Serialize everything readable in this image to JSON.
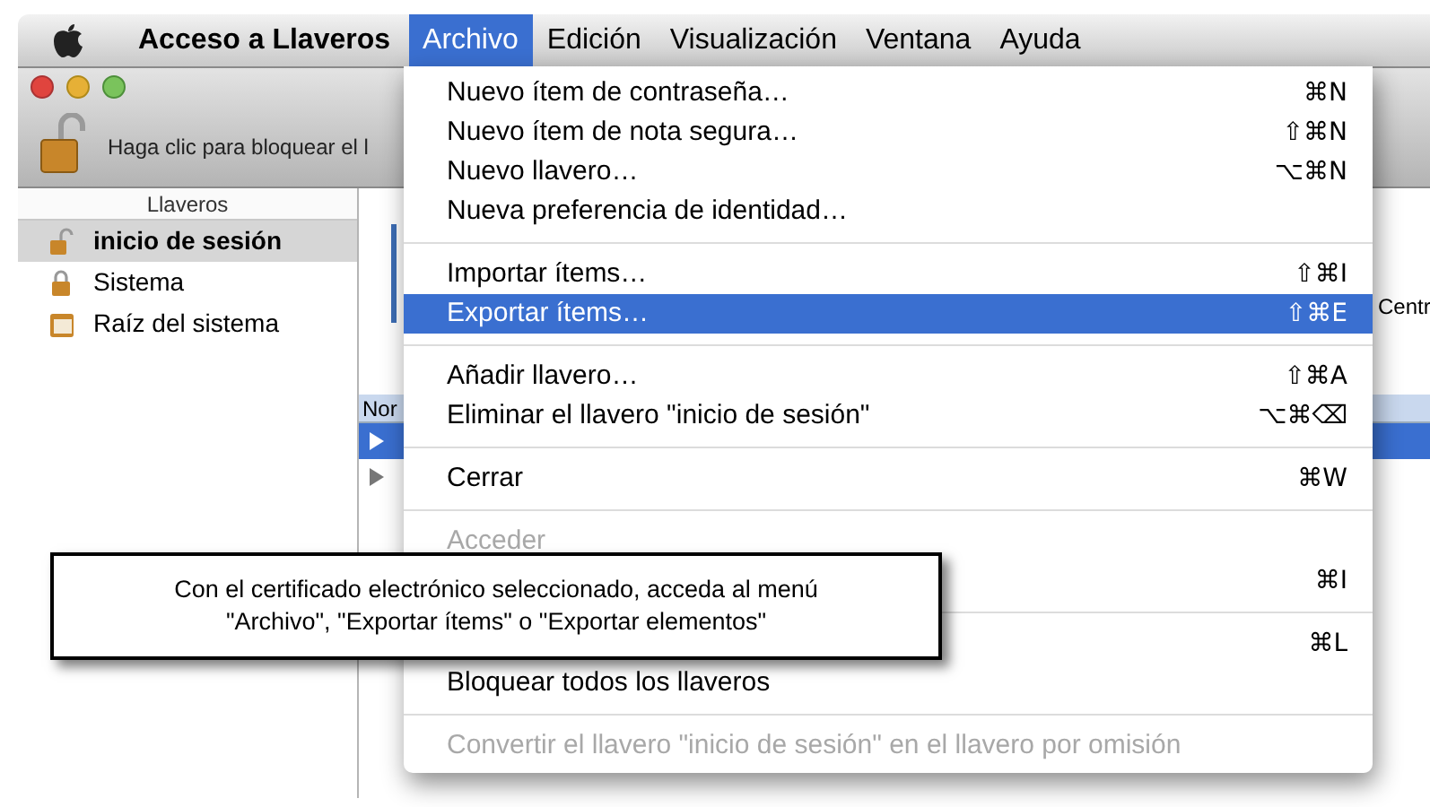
{
  "menu_bar": {
    "app_name": "Acceso a Llaveros",
    "menus": [
      {
        "label": "Archivo",
        "selected": true
      },
      {
        "label": "Edición",
        "selected": false
      },
      {
        "label": "Visualización",
        "selected": false
      },
      {
        "label": "Ventana",
        "selected": false
      },
      {
        "label": "Ayuda",
        "selected": false
      }
    ]
  },
  "window": {
    "toolbar_text": "Haga clic para bloquear el l",
    "sidebar": {
      "header": "Llaveros",
      "items": [
        {
          "label": "inicio de sesión",
          "kind": "unlocked",
          "selected": true
        },
        {
          "label": "Sistema",
          "kind": "locked",
          "selected": false
        },
        {
          "label": "Raíz del sistema",
          "kind": "folder",
          "selected": false
        }
      ]
    },
    "detail_text": "Centr",
    "list": {
      "column_1": "Nor",
      "rows": [
        {
          "selected": true
        },
        {
          "selected": false
        }
      ]
    }
  },
  "file_menu": {
    "items": [
      {
        "kind": "item",
        "label": "Nuevo ítem de contraseña…",
        "shortcut": "⌘N",
        "disabled": false,
        "selected": false
      },
      {
        "kind": "item",
        "label": "Nuevo ítem de nota segura…",
        "shortcut": "⇧⌘N",
        "disabled": false,
        "selected": false
      },
      {
        "kind": "item",
        "label": "Nuevo llavero…",
        "shortcut": "⌥⌘N",
        "disabled": false,
        "selected": false
      },
      {
        "kind": "item",
        "label": "Nueva preferencia de identidad…",
        "disabled": false,
        "selected": false
      },
      {
        "kind": "separator"
      },
      {
        "kind": "item",
        "label": "Importar ítems…",
        "shortcut": "⇧⌘I",
        "disabled": false,
        "selected": false
      },
      {
        "kind": "item",
        "label": "Exportar ítems…",
        "shortcut": "⇧⌘E",
        "disabled": false,
        "selected": true
      },
      {
        "kind": "separator"
      },
      {
        "kind": "item",
        "label": "Añadir llavero…",
        "shortcut": "⇧⌘A",
        "disabled": false,
        "selected": false
      },
      {
        "kind": "item",
        "label": "Eliminar el llavero \"inicio de sesión\"",
        "shortcut": "⌥⌘⌫",
        "disabled": false,
        "selected": false
      },
      {
        "kind": "separator"
      },
      {
        "kind": "item",
        "label": "Cerrar",
        "shortcut": "⌘W",
        "disabled": false,
        "selected": false
      },
      {
        "kind": "separator"
      },
      {
        "kind": "item",
        "label": "Acceder",
        "disabled": true,
        "selected": false
      },
      {
        "kind": "item",
        "shortcut": "⌘I",
        "disabled": false,
        "selected": false
      },
      {
        "kind": "separator"
      },
      {
        "kind": "item",
        "shortcut": "⌘L",
        "disabled": false,
        "selected": false
      },
      {
        "kind": "item",
        "label": "Bloquear todos los llaveros",
        "disabled": false,
        "selected": false
      },
      {
        "kind": "separator"
      },
      {
        "kind": "item",
        "label": "Convertir el llavero \"inicio de sesión\" en el llavero por omisión",
        "disabled": true,
        "selected": false
      }
    ]
  },
  "callout": {
    "lines": [
      "Con el certificado electrónico seleccionado, acceda al menú",
      "\"Archivo\", \"Exportar ítems\" o \"Exportar elementos\""
    ]
  }
}
